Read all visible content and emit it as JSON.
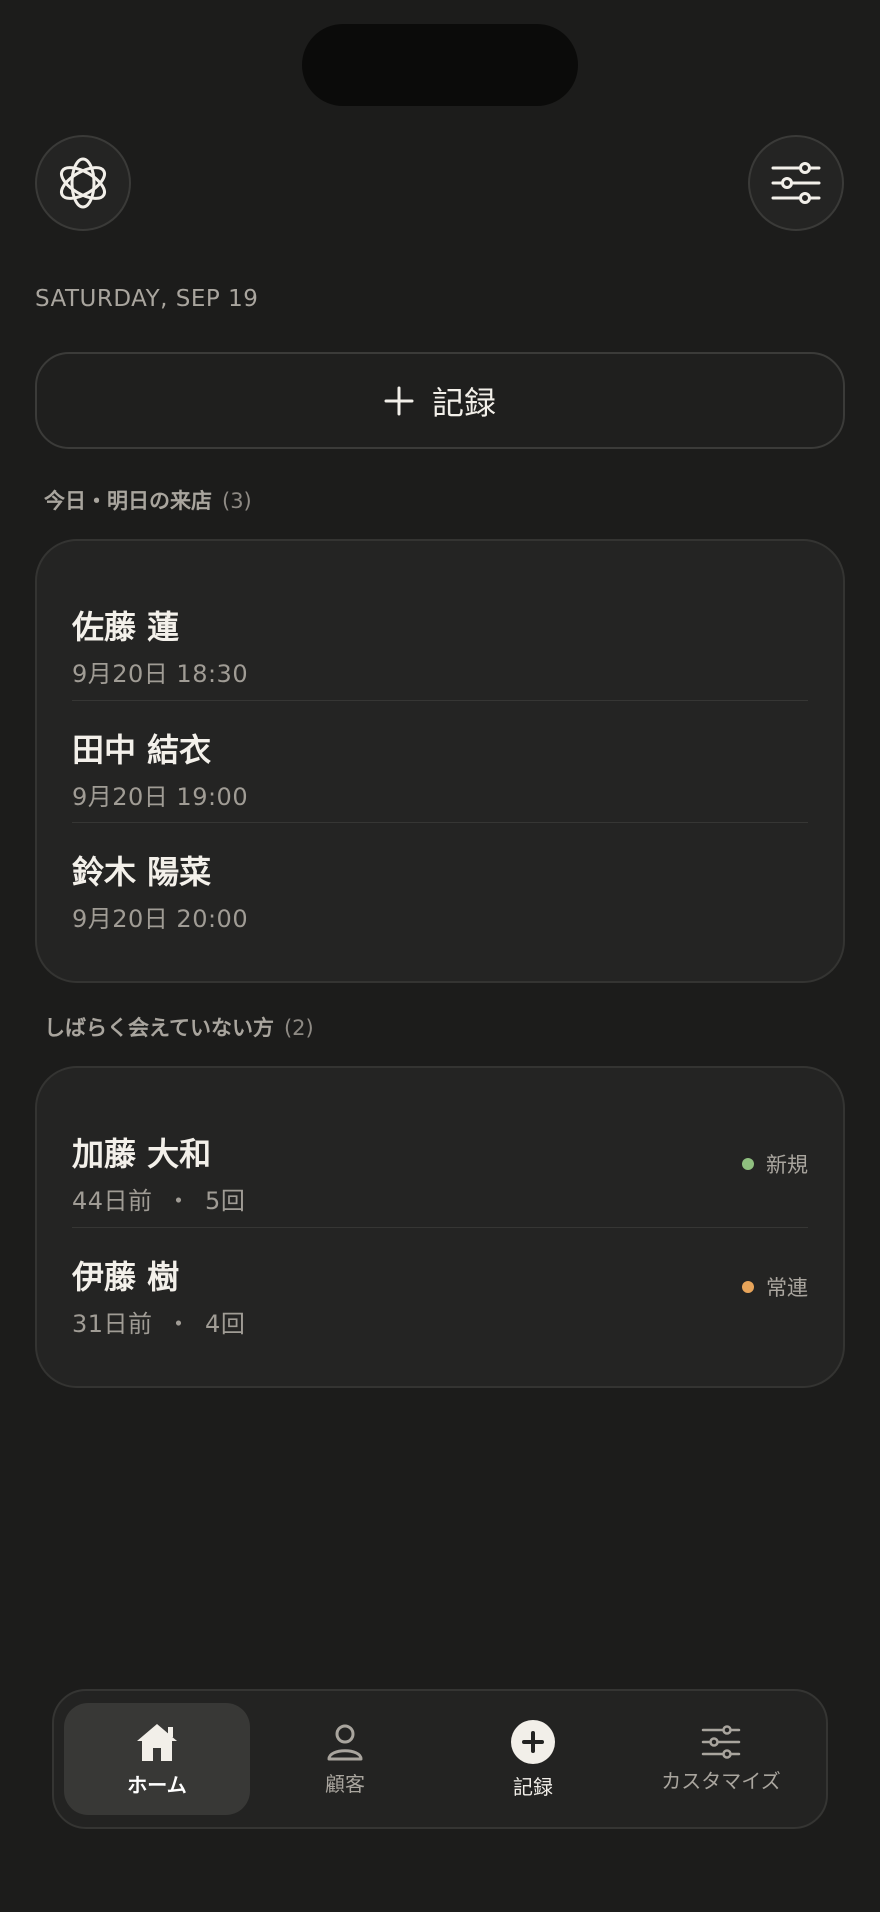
{
  "header": {
    "logo_icon": "flower-outline-icon",
    "settings_icon": "sliders-icon"
  },
  "date": "SATURDAY, SEP 19",
  "record_button": {
    "icon": "plus-icon",
    "label": "記録"
  },
  "upcoming": {
    "title": "今日・明日の来店",
    "count": "(3)",
    "items": [
      {
        "name": "佐藤 蓮",
        "datetime": "9月20日 18:30"
      },
      {
        "name": "田中 結衣",
        "datetime": "9月20日 19:00"
      },
      {
        "name": "鈴木 陽菜",
        "datetime": "9月20日 20:00"
      }
    ]
  },
  "lapsed": {
    "title": "しばらく会えていない方",
    "count": "(2)",
    "separator": "・",
    "items": [
      {
        "name": "加藤 大和",
        "days": "44日前",
        "visits": "5回",
        "tag": "新規",
        "tag_color": "#8fbf7f"
      },
      {
        "name": "伊藤 樹",
        "days": "31日前",
        "visits": "4回",
        "tag": "常連",
        "tag_color": "#e7a45a"
      }
    ]
  },
  "tabbar": {
    "tabs": [
      {
        "label": "ホーム",
        "icon": "home-icon",
        "active": true
      },
      {
        "label": "顧客",
        "icon": "person-icon",
        "active": false
      },
      {
        "label": "記録",
        "icon": "plus-circle-icon",
        "active": false
      },
      {
        "label": "カスタマイズ",
        "icon": "sliders-icon",
        "active": false
      }
    ]
  },
  "colors": {
    "background": "#1c1c1b",
    "card": "#242423",
    "text_primary": "#f2efe9",
    "text_secondary": "#a9a59e"
  }
}
